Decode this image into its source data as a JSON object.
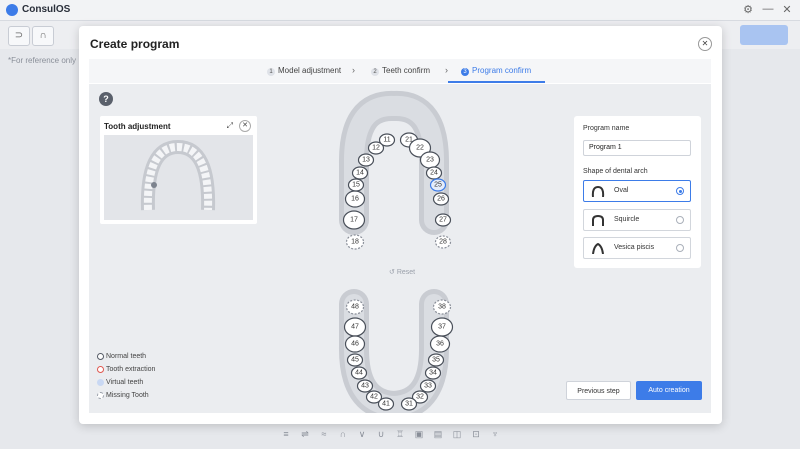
{
  "app": {
    "name": "ConsulOS"
  },
  "window": {
    "settings_icon": "gear-icon",
    "minimize_icon": "minimize-icon",
    "close_icon": "close-icon"
  },
  "reference_note": "*For reference only",
  "modal": {
    "title": "Create program",
    "steps": [
      {
        "num": "1",
        "label": "Model adjustment",
        "active": false
      },
      {
        "num": "2",
        "label": "Teeth confirm",
        "active": false
      },
      {
        "num": "3",
        "label": "Program confirm",
        "active": true
      }
    ],
    "help_label": "?",
    "tooth_adjustment": {
      "title": "Tooth adjustment"
    },
    "reset_label": "Reset",
    "upper_teeth": {
      "left": [
        "18",
        "17",
        "16",
        "15",
        "14",
        "13",
        "12",
        "11"
      ],
      "right": [
        "21",
        "22",
        "23",
        "24",
        "25",
        "26",
        "27",
        "28"
      ]
    },
    "lower_teeth": {
      "left": [
        "48",
        "47",
        "46",
        "45",
        "44",
        "43",
        "42",
        "41"
      ],
      "right": [
        "38",
        "37",
        "36",
        "35",
        "34",
        "33",
        "32",
        "31"
      ]
    },
    "legend": [
      {
        "label": "Normal teeth",
        "color": "#555b66"
      },
      {
        "label": "Tooth extraction",
        "color": "#e0574f"
      },
      {
        "label": "Virtual teeth",
        "color": "#c9d8f3"
      },
      {
        "label": "Missing Tooth",
        "color": "#9aa0aa"
      }
    ],
    "program_name_label": "Program name",
    "program_name_value": "Program 1",
    "arch_shape_label": "Shape of dental arch",
    "arch_shapes": [
      {
        "label": "Oval",
        "selected": true
      },
      {
        "label": "Squircle",
        "selected": false
      },
      {
        "label": "Vesica piscis",
        "selected": false
      }
    ],
    "previous_button": "Previous step",
    "auto_button": "Auto creation"
  },
  "colors": {
    "accent": "#3d7ce8",
    "canvas": "#ebedf0"
  }
}
